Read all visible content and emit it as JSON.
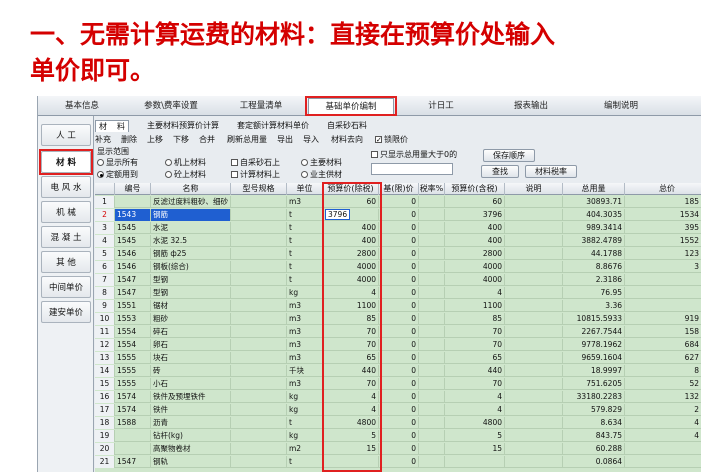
{
  "headline": {
    "line1": "一、无需计算运费的材料：直接在预算价处输入",
    "line2": "单价即可。"
  },
  "top_tabs": [
    "基本信息",
    "参数\\费率设置",
    "工程量清单",
    "基础单价编制",
    "计日工",
    "报表输出",
    "编制说明"
  ],
  "top_tabs_active": "基础单价编制",
  "side_tabs": [
    "人  工",
    "材  料",
    "电 风 水",
    "机  械",
    "混 凝 土",
    "其  他",
    "中间单价",
    "建安单价"
  ],
  "side_tabs_active": "材  料",
  "sub_tabs": [
    "材",
    "料",
    "主要材料预算价计算",
    "套定额计算材料单价",
    "自采砂石料"
  ],
  "toolbar": [
    "补充",
    "删除",
    "上移",
    "下移",
    "合并",
    "刷新总用量",
    "导出",
    "导入",
    "材料去向"
  ],
  "lock_price": "锁限价",
  "filter": {
    "display_range_label": "显示范围",
    "options": [
      {
        "label": "显示所有",
        "checked": false
      },
      {
        "label": "机上材料",
        "checked": false
      },
      {
        "label": "自采砂石上",
        "checked": false
      },
      {
        "label": "主要材料",
        "checked": false
      },
      {
        "label": "定额用到",
        "checked": true
      },
      {
        "label": "砼上材料",
        "checked": false
      },
      {
        "label": "计算材料上",
        "checked": false
      },
      {
        "label": "业主供材",
        "checked": false
      }
    ],
    "only_usage_label": "只显示总用量大于0的",
    "save_order_button": "保存顺序",
    "find_button": "查找",
    "material_tax_button": "材料税率"
  },
  "columns": [
    "",
    "编号",
    "名称",
    "型号规格",
    "单位",
    "预算价(除税)",
    "基(限)价",
    "税率%",
    "预算价(含税)",
    "说明",
    "总用量",
    "总价"
  ],
  "rows": [
    {
      "n": "1",
      "code": "",
      "name": "反滤过度料粗砂、细砂",
      "spec": "",
      "unit": "m3",
      "price": "60",
      "limit": "0",
      "tax": "",
      "price_tax": "60",
      "note": "",
      "qty": "30893.71",
      "total": "185"
    },
    {
      "n": "2",
      "code": "1543",
      "name": "钢筋",
      "spec": "",
      "unit": "t",
      "price": "3796",
      "limit": "0",
      "tax": "",
      "price_tax": "3796",
      "note": "",
      "qty": "404.3035",
      "total": "1534"
    },
    {
      "n": "3",
      "code": "1545",
      "name": "水泥",
      "spec": "",
      "unit": "t",
      "price": "400",
      "limit": "0",
      "tax": "",
      "price_tax": "400",
      "note": "",
      "qty": "989.3414",
      "total": "395"
    },
    {
      "n": "4",
      "code": "1545",
      "name": "水泥 32.5",
      "spec": "",
      "unit": "t",
      "price": "400",
      "limit": "0",
      "tax": "",
      "price_tax": "400",
      "note": "",
      "qty": "3882.4789",
      "total": "1552"
    },
    {
      "n": "5",
      "code": "1546",
      "name": "钢筋 ф25",
      "spec": "",
      "unit": "t",
      "price": "2800",
      "limit": "0",
      "tax": "",
      "price_tax": "2800",
      "note": "",
      "qty": "44.1788",
      "total": "123"
    },
    {
      "n": "6",
      "code": "1546",
      "name": "钢板(综合)",
      "spec": "",
      "unit": "t",
      "price": "4000",
      "limit": "0",
      "tax": "",
      "price_tax": "4000",
      "note": "",
      "qty": "8.8676",
      "total": "3"
    },
    {
      "n": "7",
      "code": "1547",
      "name": "型钢",
      "spec": "",
      "unit": "t",
      "price": "4000",
      "limit": "0",
      "tax": "",
      "price_tax": "4000",
      "note": "",
      "qty": "2.3186",
      "total": ""
    },
    {
      "n": "8",
      "code": "1547",
      "name": "型钢",
      "spec": "",
      "unit": "kg",
      "price": "4",
      "limit": "0",
      "tax": "",
      "price_tax": "4",
      "note": "",
      "qty": "76.95",
      "total": ""
    },
    {
      "n": "9",
      "code": "1551",
      "name": "锯材",
      "spec": "",
      "unit": "m3",
      "price": "1100",
      "limit": "0",
      "tax": "",
      "price_tax": "1100",
      "note": "",
      "qty": "3.36",
      "total": ""
    },
    {
      "n": "10",
      "code": "1553",
      "name": "粗砂",
      "spec": "",
      "unit": "m3",
      "price": "85",
      "limit": "0",
      "tax": "",
      "price_tax": "85",
      "note": "",
      "qty": "10815.5933",
      "total": "919"
    },
    {
      "n": "11",
      "code": "1554",
      "name": "碎石",
      "spec": "",
      "unit": "m3",
      "price": "70",
      "limit": "0",
      "tax": "",
      "price_tax": "70",
      "note": "",
      "qty": "2267.7544",
      "total": "158"
    },
    {
      "n": "12",
      "code": "1554",
      "name": "卵石",
      "spec": "",
      "unit": "m3",
      "price": "70",
      "limit": "0",
      "tax": "",
      "price_tax": "70",
      "note": "",
      "qty": "9778.1962",
      "total": "684"
    },
    {
      "n": "13",
      "code": "1555",
      "name": "块石",
      "spec": "",
      "unit": "m3",
      "price": "65",
      "limit": "0",
      "tax": "",
      "price_tax": "65",
      "note": "",
      "qty": "9659.1604",
      "total": "627"
    },
    {
      "n": "14",
      "code": "1555",
      "name": "砖",
      "spec": "",
      "unit": "千块",
      "price": "440",
      "limit": "0",
      "tax": "",
      "price_tax": "440",
      "note": "",
      "qty": "18.9997",
      "total": "8"
    },
    {
      "n": "15",
      "code": "1555",
      "name": "小石",
      "spec": "",
      "unit": "m3",
      "price": "70",
      "limit": "0",
      "tax": "",
      "price_tax": "70",
      "note": "",
      "qty": "751.6205",
      "total": "52"
    },
    {
      "n": "16",
      "code": "1574",
      "name": "铁件及预埋铁件",
      "spec": "",
      "unit": "kg",
      "price": "4",
      "limit": "0",
      "tax": "",
      "price_tax": "4",
      "note": "",
      "qty": "33180.2283",
      "total": "132"
    },
    {
      "n": "17",
      "code": "1574",
      "name": "铁件",
      "spec": "",
      "unit": "kg",
      "price": "4",
      "limit": "0",
      "tax": "",
      "price_tax": "4",
      "note": "",
      "qty": "579.829",
      "total": "2"
    },
    {
      "n": "18",
      "code": "1588",
      "name": "沥青",
      "spec": "",
      "unit": "t",
      "price": "4800",
      "limit": "0",
      "tax": "",
      "price_tax": "4800",
      "note": "",
      "qty": "8.634",
      "total": "4"
    },
    {
      "n": "19",
      "code": "",
      "name": "钻杆(kg)",
      "spec": "",
      "unit": "kg",
      "price": "5",
      "limit": "0",
      "tax": "",
      "price_tax": "5",
      "note": "",
      "qty": "843.75",
      "total": "4"
    },
    {
      "n": "20",
      "code": "",
      "name": "高聚物卷材",
      "spec": "",
      "unit": "m2",
      "price": "15",
      "limit": "0",
      "tax": "",
      "price_tax": "15",
      "note": "",
      "qty": "60.288",
      "total": ""
    },
    {
      "n": "21",
      "code": "1547",
      "name": "钢轨",
      "spec": "",
      "unit": "t",
      "price": "",
      "limit": "0",
      "tax": "",
      "price_tax": "",
      "note": "",
      "qty": "0.0864",
      "total": ""
    }
  ],
  "selected_row": "2",
  "colors": {
    "headline": "#d40000",
    "highlight": "#e02020",
    "grid_bg": "#cfe6cc",
    "selection": "#1f5fd1"
  }
}
